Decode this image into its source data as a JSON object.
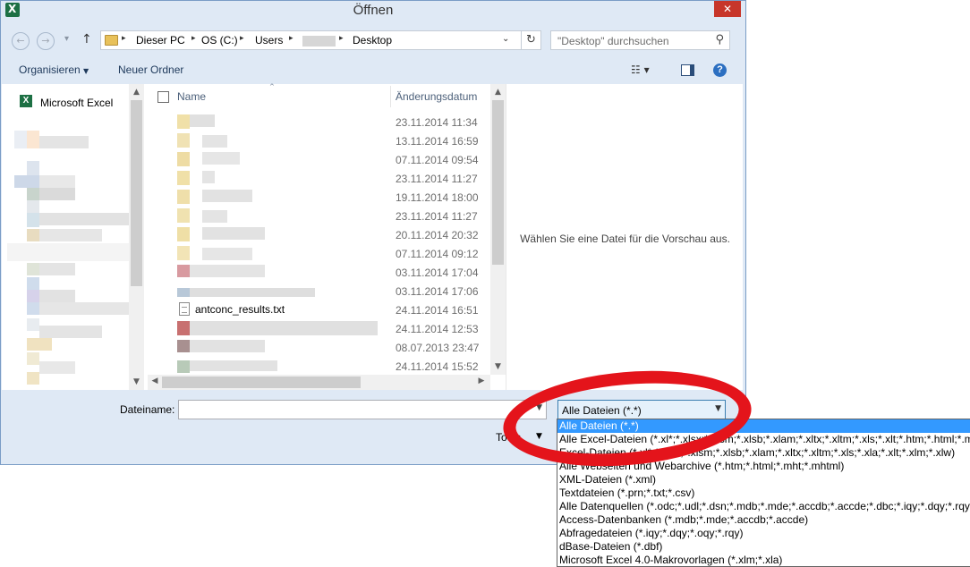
{
  "window": {
    "title": "Öffnen",
    "close_glyph": "✕"
  },
  "nav": {
    "back_glyph": "←",
    "forward_glyph": "→",
    "history_glyph": "▾",
    "up_glyph": "↑",
    "breadcrumbs": [
      "Dieser PC",
      "OS (C:)",
      "Users",
      "Desktop"
    ],
    "separator": "▸",
    "dropdown_glyph": "⌄",
    "refresh_glyph": "↻"
  },
  "search": {
    "placeholder": "\"Desktop\" durchsuchen",
    "icon_glyph": "⚲"
  },
  "toolbar": {
    "organize_label": "Organisieren",
    "new_folder_label": "Neuer Ordner",
    "arrow_glyph": "▼",
    "view_glyph": "☷ ▾",
    "help_glyph": "?"
  },
  "navpane": {
    "excel_label": "Microsoft Excel",
    "excel_glyph": "X"
  },
  "filelist": {
    "columns": {
      "name": "Name",
      "date": "Änderungsdatum",
      "sort_glyph": "^"
    },
    "rows": [
      {
        "date": "23.11.2014 11:34"
      },
      {
        "date": "13.11.2014 16:59"
      },
      {
        "date": "07.11.2014 09:54"
      },
      {
        "date": "23.11.2014 11:27"
      },
      {
        "date": "19.11.2014 18:00"
      },
      {
        "date": "23.11.2014 11:27"
      },
      {
        "date": "20.11.2014 20:32"
      },
      {
        "date": "07.11.2014 09:12"
      },
      {
        "date": "03.11.2014 17:04"
      },
      {
        "date": "03.11.2014 17:06"
      },
      {
        "name": "antconc_results.txt",
        "date": "24.11.2014 16:51"
      },
      {
        "date": "24.11.2014 12:53"
      },
      {
        "date": "08.07.2013 23:47"
      },
      {
        "date": "24.11.2014 15:52"
      }
    ],
    "scroll_up": "▲",
    "scroll_down": "▼",
    "scroll_left": "◀",
    "scroll_right": "▶"
  },
  "preview": {
    "text": "Wählen Sie eine Datei für die Vorschau aus."
  },
  "footer": {
    "filename_label": "Dateiname:",
    "filename_value": "",
    "filename_drop_glyph": "▼",
    "tools_label": "Tools",
    "tools_arrow": "▼"
  },
  "filetype": {
    "selected": "Alle Dateien (*.*)",
    "arrow_glyph": "▼",
    "options": [
      "Alle Dateien (*.*)",
      "Alle Excel-Dateien (*.xl*;*.xlsx;*.xlsm;*.xlsb;*.xlam;*.xltx;*.xltm;*.xls;*.xlt;*.htm;*.html;*.mht;*.mhtml;*.xml;*.xla;*.xlm;*.xlw;*.odc;*.ods)",
      "Excel-Dateien (*.xl*;*.xlsx;*.xlsm;*.xlsb;*.xlam;*.xltx;*.xltm;*.xls;*.xla;*.xlt;*.xlm;*.xlw)",
      "Alle Webseiten und Webarchive (*.htm;*.html;*.mht;*.mhtml)",
      "XML-Dateien (*.xml)",
      "Textdateien (*.prn;*.txt;*.csv)",
      "Alle Datenquellen (*.odc;*.udl;*.dsn;*.mdb;*.mde;*.accdb;*.accde;*.dbc;*.iqy;*.dqy;*.rqy;*.oqy;*.cub;*.atom;*.atomsvc)",
      "Access-Datenbanken (*.mdb;*.mde;*.accdb;*.accde)",
      "Abfragedateien (*.iqy;*.dqy;*.oqy;*.rqy)",
      "dBase-Dateien (*.dbf)",
      "Microsoft Excel 4.0-Makrovorlagen (*.xlm;*.xla)"
    ]
  },
  "colors": {
    "dialog_bg": "#dfe9f5",
    "accent": "#3399ff",
    "annotation": "#e4141b"
  }
}
